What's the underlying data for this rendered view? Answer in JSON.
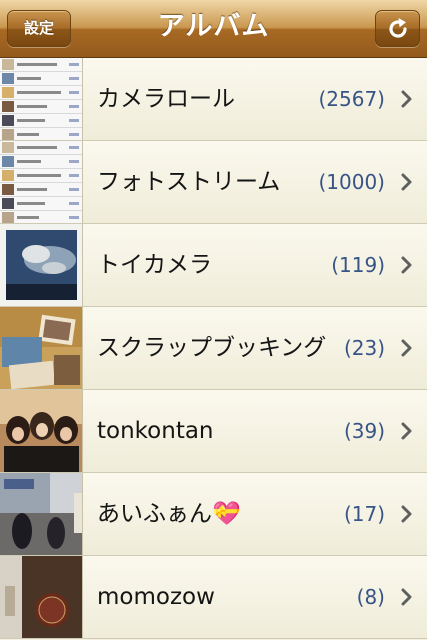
{
  "navbar": {
    "title": "アルバム",
    "left_button": "設定",
    "right_button_icon": "refresh-icon"
  },
  "albums": [
    {
      "name": "カメラロール",
      "count": "(2567)"
    },
    {
      "name": "フォトストリーム",
      "count": "(1000)"
    },
    {
      "name": "トイカメラ",
      "count": "(119)"
    },
    {
      "name": "スクラップブッキング",
      "count": "(23)"
    },
    {
      "name": "tonkontan",
      "count": "(39)"
    },
    {
      "name": "あいふぁん💝",
      "count": "(17)"
    },
    {
      "name": "momozow",
      "count": "(8)"
    }
  ],
  "colors": {
    "nav_bar": "#a86a24",
    "count_text": "#385487",
    "row_bg": "#f4f1e3"
  }
}
